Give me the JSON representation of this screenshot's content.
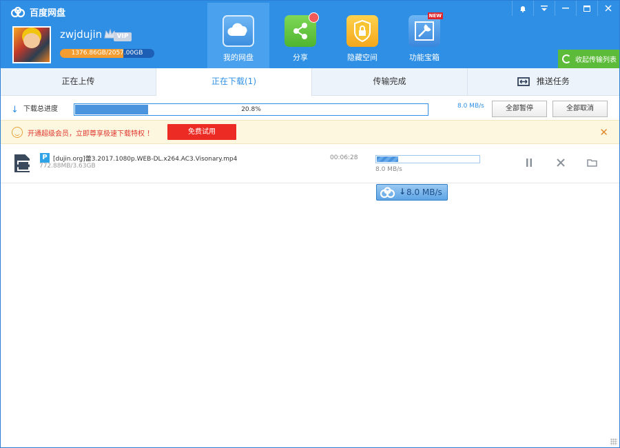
{
  "app": {
    "title": "百度网盘"
  },
  "user": {
    "name": "zwjdujin",
    "vip_label": "VIP",
    "quota_text": "1376.86GB/2057.00GB",
    "quota_fraction": 0.669
  },
  "nav": [
    {
      "label": "我的网盘",
      "icon": "cloud-icon",
      "active": true
    },
    {
      "label": "分享",
      "icon": "share-icon",
      "badge_dot": true
    },
    {
      "label": "隐藏空间",
      "icon": "lock-icon"
    },
    {
      "label": "功能宝箱",
      "icon": "toolbox-icon",
      "badge": "NEW"
    }
  ],
  "collapse_label": "收起传输列表",
  "tabs": [
    {
      "label": "正在上传"
    },
    {
      "label": "正在下载(1)",
      "active": true
    },
    {
      "label": "传输完成"
    },
    {
      "label": "推送任务"
    }
  ],
  "total": {
    "label": "下载总进度",
    "percent_text": "20.8%",
    "fraction": 0.208,
    "speed": "8.0 MB/s",
    "pause_all": "全部暂停",
    "cancel_all": "全部取消"
  },
  "promo": {
    "text": "开通超级会员，立即尊享极速下载特权 ！",
    "button": "免费试用"
  },
  "download": {
    "name": "[dujin.org]蕾3.2017.1080p.WEB-DL.x264.AC3.Visonary.mp4",
    "size": "772.88MB/3.63GB",
    "time_left": "00:06:28",
    "speed": "8.0 MB/s",
    "fraction": 0.208
  },
  "speed_badge": {
    "text": "8.0 MB/s"
  },
  "colors": {
    "header": "#2e8fe5",
    "accent": "#2e8fe5",
    "promo_red": "#ec2c24",
    "collapse_green": "#5dbb3a"
  }
}
